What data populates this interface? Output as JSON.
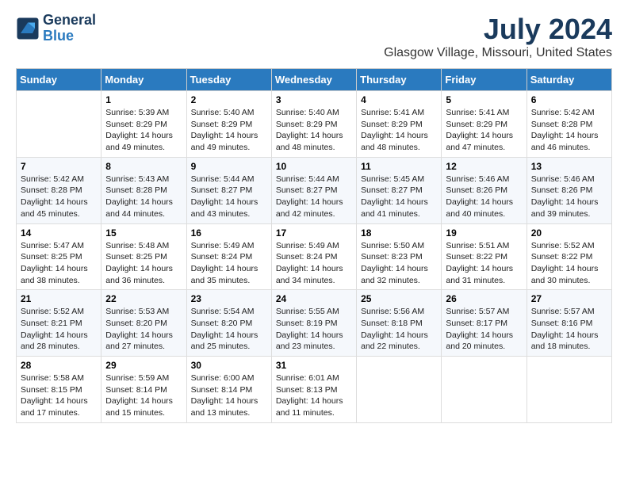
{
  "logo": {
    "line1": "General",
    "line2": "Blue"
  },
  "title": "July 2024",
  "subtitle": "Glasgow Village, Missouri, United States",
  "days_header": [
    "Sunday",
    "Monday",
    "Tuesday",
    "Wednesday",
    "Thursday",
    "Friday",
    "Saturday"
  ],
  "weeks": [
    [
      {
        "num": "",
        "info": ""
      },
      {
        "num": "1",
        "info": "Sunrise: 5:39 AM\nSunset: 8:29 PM\nDaylight: 14 hours\nand 49 minutes."
      },
      {
        "num": "2",
        "info": "Sunrise: 5:40 AM\nSunset: 8:29 PM\nDaylight: 14 hours\nand 49 minutes."
      },
      {
        "num": "3",
        "info": "Sunrise: 5:40 AM\nSunset: 8:29 PM\nDaylight: 14 hours\nand 48 minutes."
      },
      {
        "num": "4",
        "info": "Sunrise: 5:41 AM\nSunset: 8:29 PM\nDaylight: 14 hours\nand 48 minutes."
      },
      {
        "num": "5",
        "info": "Sunrise: 5:41 AM\nSunset: 8:29 PM\nDaylight: 14 hours\nand 47 minutes."
      },
      {
        "num": "6",
        "info": "Sunrise: 5:42 AM\nSunset: 8:28 PM\nDaylight: 14 hours\nand 46 minutes."
      }
    ],
    [
      {
        "num": "7",
        "info": "Sunrise: 5:42 AM\nSunset: 8:28 PM\nDaylight: 14 hours\nand 45 minutes."
      },
      {
        "num": "8",
        "info": "Sunrise: 5:43 AM\nSunset: 8:28 PM\nDaylight: 14 hours\nand 44 minutes."
      },
      {
        "num": "9",
        "info": "Sunrise: 5:44 AM\nSunset: 8:27 PM\nDaylight: 14 hours\nand 43 minutes."
      },
      {
        "num": "10",
        "info": "Sunrise: 5:44 AM\nSunset: 8:27 PM\nDaylight: 14 hours\nand 42 minutes."
      },
      {
        "num": "11",
        "info": "Sunrise: 5:45 AM\nSunset: 8:27 PM\nDaylight: 14 hours\nand 41 minutes."
      },
      {
        "num": "12",
        "info": "Sunrise: 5:46 AM\nSunset: 8:26 PM\nDaylight: 14 hours\nand 40 minutes."
      },
      {
        "num": "13",
        "info": "Sunrise: 5:46 AM\nSunset: 8:26 PM\nDaylight: 14 hours\nand 39 minutes."
      }
    ],
    [
      {
        "num": "14",
        "info": "Sunrise: 5:47 AM\nSunset: 8:25 PM\nDaylight: 14 hours\nand 38 minutes."
      },
      {
        "num": "15",
        "info": "Sunrise: 5:48 AM\nSunset: 8:25 PM\nDaylight: 14 hours\nand 36 minutes."
      },
      {
        "num": "16",
        "info": "Sunrise: 5:49 AM\nSunset: 8:24 PM\nDaylight: 14 hours\nand 35 minutes."
      },
      {
        "num": "17",
        "info": "Sunrise: 5:49 AM\nSunset: 8:24 PM\nDaylight: 14 hours\nand 34 minutes."
      },
      {
        "num": "18",
        "info": "Sunrise: 5:50 AM\nSunset: 8:23 PM\nDaylight: 14 hours\nand 32 minutes."
      },
      {
        "num": "19",
        "info": "Sunrise: 5:51 AM\nSunset: 8:22 PM\nDaylight: 14 hours\nand 31 minutes."
      },
      {
        "num": "20",
        "info": "Sunrise: 5:52 AM\nSunset: 8:22 PM\nDaylight: 14 hours\nand 30 minutes."
      }
    ],
    [
      {
        "num": "21",
        "info": "Sunrise: 5:52 AM\nSunset: 8:21 PM\nDaylight: 14 hours\nand 28 minutes."
      },
      {
        "num": "22",
        "info": "Sunrise: 5:53 AM\nSunset: 8:20 PM\nDaylight: 14 hours\nand 27 minutes."
      },
      {
        "num": "23",
        "info": "Sunrise: 5:54 AM\nSunset: 8:20 PM\nDaylight: 14 hours\nand 25 minutes."
      },
      {
        "num": "24",
        "info": "Sunrise: 5:55 AM\nSunset: 8:19 PM\nDaylight: 14 hours\nand 23 minutes."
      },
      {
        "num": "25",
        "info": "Sunrise: 5:56 AM\nSunset: 8:18 PM\nDaylight: 14 hours\nand 22 minutes."
      },
      {
        "num": "26",
        "info": "Sunrise: 5:57 AM\nSunset: 8:17 PM\nDaylight: 14 hours\nand 20 minutes."
      },
      {
        "num": "27",
        "info": "Sunrise: 5:57 AM\nSunset: 8:16 PM\nDaylight: 14 hours\nand 18 minutes."
      }
    ],
    [
      {
        "num": "28",
        "info": "Sunrise: 5:58 AM\nSunset: 8:15 PM\nDaylight: 14 hours\nand 17 minutes."
      },
      {
        "num": "29",
        "info": "Sunrise: 5:59 AM\nSunset: 8:14 PM\nDaylight: 14 hours\nand 15 minutes."
      },
      {
        "num": "30",
        "info": "Sunrise: 6:00 AM\nSunset: 8:14 PM\nDaylight: 14 hours\nand 13 minutes."
      },
      {
        "num": "31",
        "info": "Sunrise: 6:01 AM\nSunset: 8:13 PM\nDaylight: 14 hours\nand 11 minutes."
      },
      {
        "num": "",
        "info": ""
      },
      {
        "num": "",
        "info": ""
      },
      {
        "num": "",
        "info": ""
      }
    ]
  ]
}
